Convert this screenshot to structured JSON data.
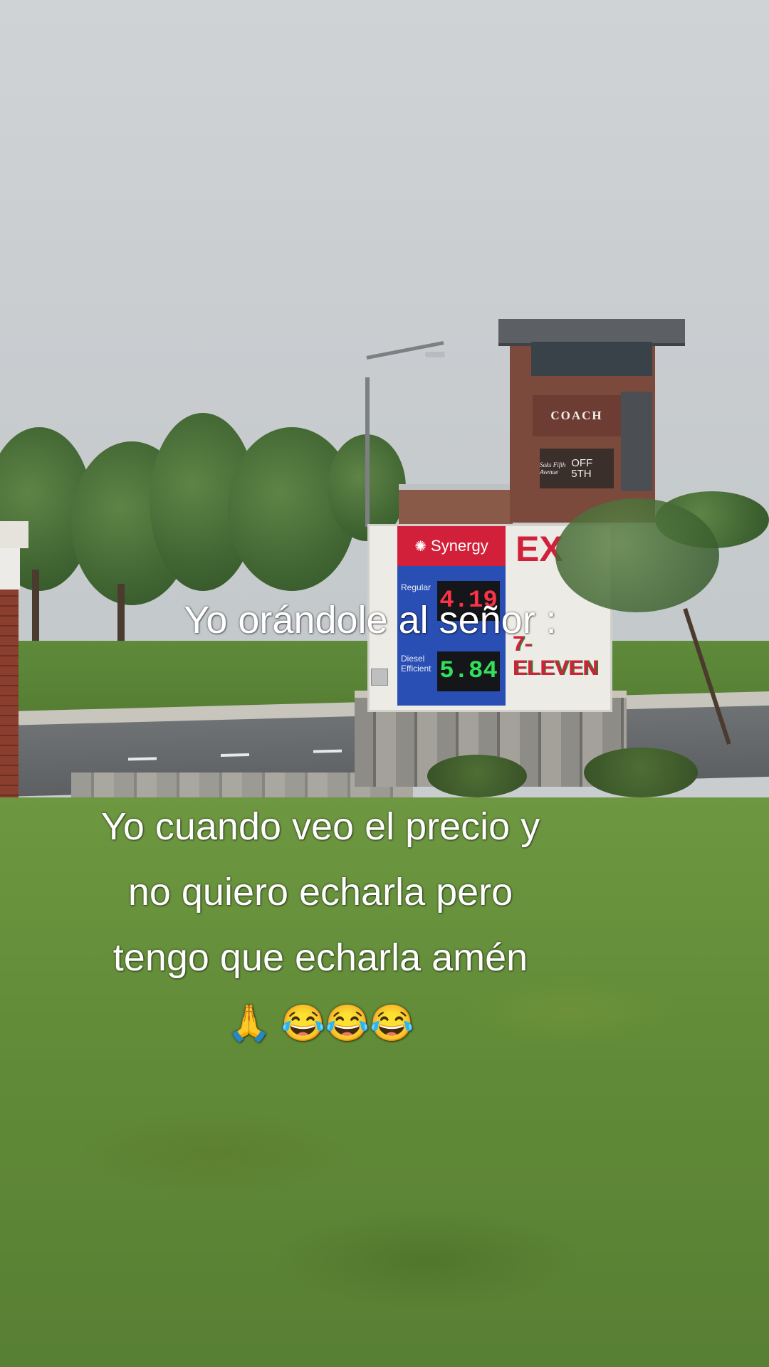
{
  "photo": {
    "subject": "",
    "colors": {
      "sky": "#c8cccf",
      "grass": "#628c38",
      "sign_red": "#d3203a",
      "sign_blue": "#2a4fb4"
    }
  },
  "scene_text": {
    "synergy_label": "Synergy",
    "regular_label": "Regular",
    "regular_price": "4.19",
    "diesel_label": "Diesel Efficient",
    "diesel_price": "5.84",
    "exxon_label": "EX",
    "seven_eleven_label": "7-ELEVEN",
    "coach_label": "COACH",
    "saks_label": "Saks Fifth Avenue",
    "off5th_label": "OFF 5TH"
  },
  "captions": {
    "top": "Yo orándole al señor :",
    "bottom_line1": "Yo cuando veo el precio y",
    "bottom_line2": "no quiero echarla pero",
    "bottom_line3": "tengo que echarla amén",
    "emojis": "🙏 😂😂😂"
  }
}
